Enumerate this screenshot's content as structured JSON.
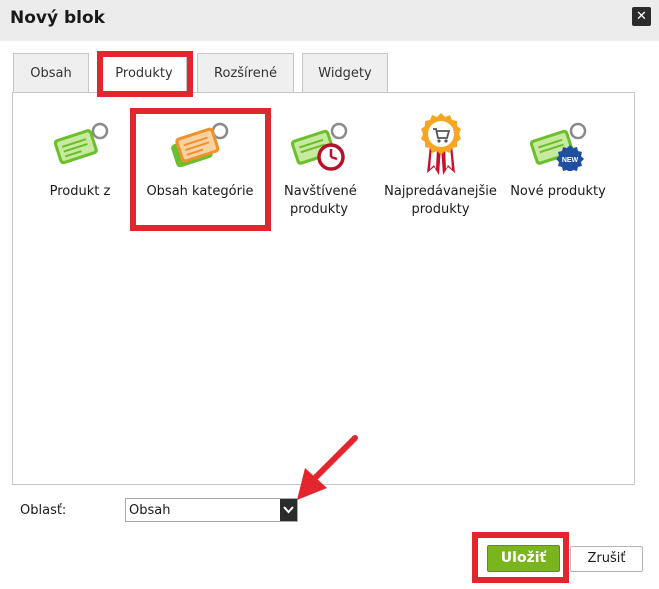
{
  "dialog": {
    "title": "Nový blok",
    "close_symbol": "✕"
  },
  "tabs": [
    {
      "label": "Obsah"
    },
    {
      "label": "Produkty",
      "active": true
    },
    {
      "label": "Rozšírené"
    },
    {
      "label": "Widgety"
    }
  ],
  "blocks": [
    {
      "label": "Produkt z",
      "icon": "green-tag-icon"
    },
    {
      "label": "Obsah kategórie",
      "icon": "orange-tag-icon",
      "highlighted": true
    },
    {
      "label": "Navštívené produkty",
      "icon": "tag-clock-icon"
    },
    {
      "label": "Najpredávanejšie produkty",
      "icon": "award-cart-icon"
    },
    {
      "label": "Nové produkty",
      "icon": "tag-new-icon",
      "badge": "NEW"
    }
  ],
  "area": {
    "label": "Oblasť:",
    "value": "Obsah"
  },
  "buttons": {
    "save": "Uložiť",
    "cancel": "Zrušiť"
  },
  "colors": {
    "highlight": "#e3262d",
    "save": "#7ab51d",
    "tag_green": "#6bbf2b",
    "tag_orange": "#f0922c"
  }
}
